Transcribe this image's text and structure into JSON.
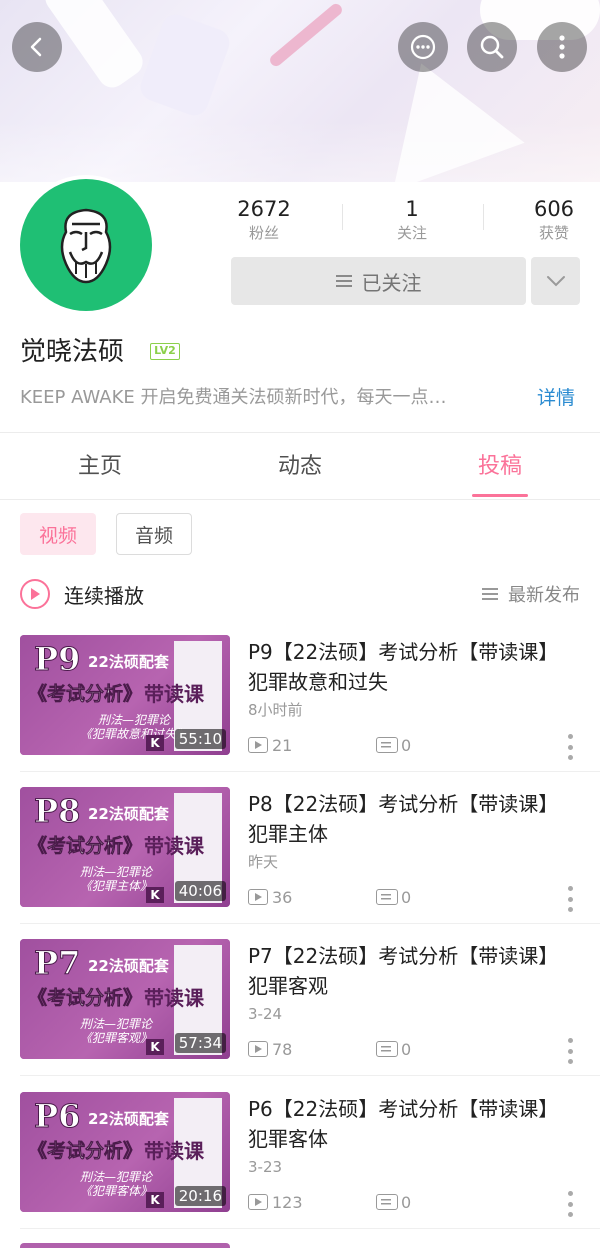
{
  "profile": {
    "name": "觉晓法硕",
    "level": "LV2",
    "signature": "KEEP AWAKE 开启免费通关法硕新时代，每天一点…",
    "detail_link": "详情",
    "follow_button": "已关注",
    "avatar_color": "#1fbf74"
  },
  "stats": [
    {
      "value": "2672",
      "label": "粉丝"
    },
    {
      "value": "1",
      "label": "关注"
    },
    {
      "value": "606",
      "label": "获赞"
    }
  ],
  "tabs": [
    {
      "label": "主页"
    },
    {
      "label": "动态"
    },
    {
      "label": "投稿",
      "active": true
    }
  ],
  "filters": {
    "video": "视频",
    "audio": "音频",
    "play_all": "连续播放",
    "sort": "最新发布"
  },
  "videos": [
    {
      "thumb_num": "P9",
      "thumb_sub": "刑法—犯罪论\n《犯罪故意和过失》",
      "duration": "55:10",
      "title": "P9【22法硕】考试分析【带读课】犯罪故意和过失",
      "time": "8小时前",
      "plays": "21",
      "danmaku": "0"
    },
    {
      "thumb_num": "P8",
      "thumb_sub": "刑法—犯罪论\n《犯罪主体》",
      "duration": "40:06",
      "title": "P8【22法硕】考试分析【带读课】犯罪主体",
      "time": "昨天",
      "plays": "36",
      "danmaku": "0"
    },
    {
      "thumb_num": "P7",
      "thumb_sub": "刑法—犯罪论\n《犯罪客观》",
      "duration": "57:34",
      "title": "P7【22法硕】考试分析【带读课】犯罪客观",
      "time": "3-24",
      "plays": "78",
      "danmaku": "0"
    },
    {
      "thumb_num": "P6",
      "thumb_sub": "刑法—犯罪论\n《犯罪客体》",
      "duration": "20:16",
      "title": "P6【22法硕】考试分析【带读课】犯罪客体",
      "time": "3-23",
      "plays": "123",
      "danmaku": "0"
    }
  ],
  "thumb_text": {
    "series": "22法硕配套",
    "course": "《考试分析》",
    "tag": "带读课",
    "k": "K"
  },
  "colors": {
    "accent": "#fb7299",
    "link": "#2a8bd1",
    "level": "#8bd04a",
    "thumb": "#a0509f"
  },
  "icons": [
    "back-arrow-icon",
    "message-icon",
    "search-icon",
    "more-vertical-icon",
    "menu-lines-icon",
    "chevron-down-icon",
    "play-circle-icon",
    "play-count-icon",
    "danmaku-icon"
  ]
}
